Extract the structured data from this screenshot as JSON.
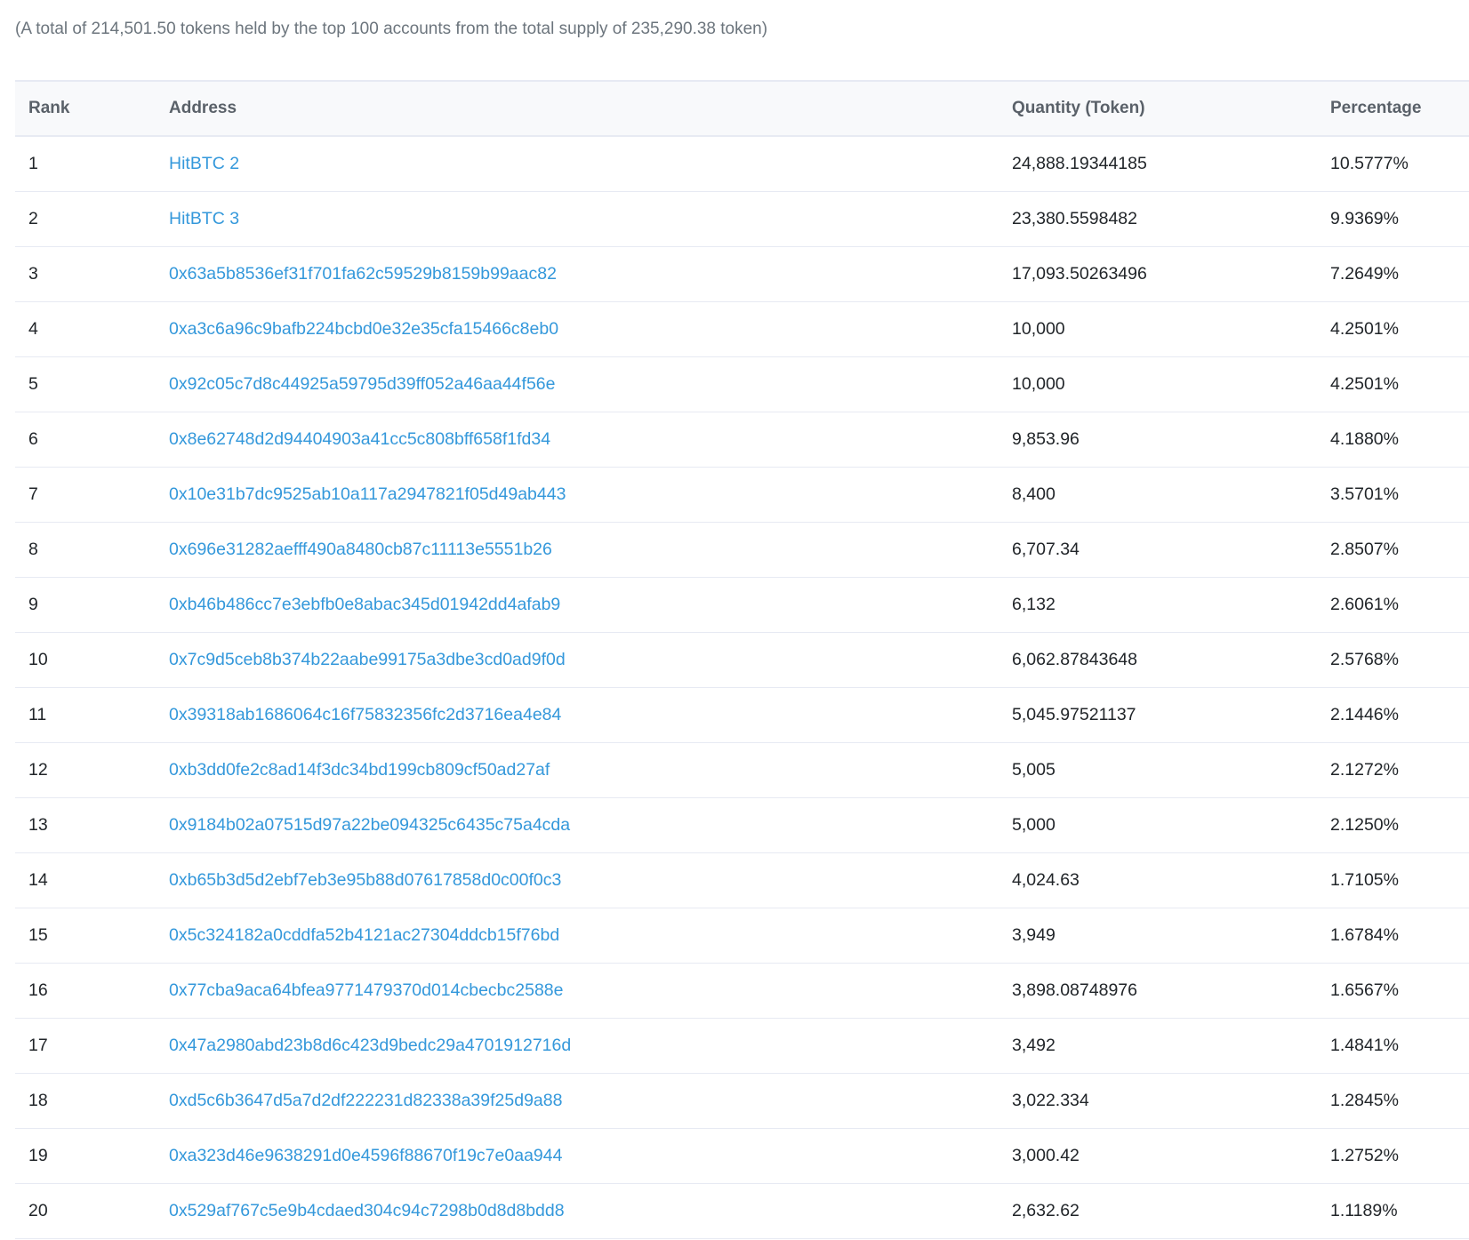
{
  "summary": "(A total of 214,501.50 tokens held by the top 100 accounts from the total supply of 235,290.38 token)",
  "colors": {
    "link": "#3498db",
    "header_bg": "#f8f9fb",
    "border": "#e7eaf3",
    "muted_text": "#6c757d"
  },
  "table": {
    "headers": {
      "rank": "Rank",
      "address": "Address",
      "quantity": "Quantity (Token)",
      "percentage": "Percentage"
    },
    "rows": [
      {
        "rank": "1",
        "address": "HitBTC 2",
        "quantity": "24,888.19344185",
        "percentage": "10.5777%"
      },
      {
        "rank": "2",
        "address": "HitBTC 3",
        "quantity": "23,380.5598482",
        "percentage": "9.9369%"
      },
      {
        "rank": "3",
        "address": "0x63a5b8536ef31f701fa62c59529b8159b99aac82",
        "quantity": "17,093.50263496",
        "percentage": "7.2649%"
      },
      {
        "rank": "4",
        "address": "0xa3c6a96c9bafb224bcbd0e32e35cfa15466c8eb0",
        "quantity": "10,000",
        "percentage": "4.2501%"
      },
      {
        "rank": "5",
        "address": "0x92c05c7d8c44925a59795d39ff052a46aa44f56e",
        "quantity": "10,000",
        "percentage": "4.2501%"
      },
      {
        "rank": "6",
        "address": "0x8e62748d2d94404903a41cc5c808bff658f1fd34",
        "quantity": "9,853.96",
        "percentage": "4.1880%"
      },
      {
        "rank": "7",
        "address": "0x10e31b7dc9525ab10a117a2947821f05d49ab443",
        "quantity": "8,400",
        "percentage": "3.5701%"
      },
      {
        "rank": "8",
        "address": "0x696e31282aefff490a8480cb87c11113e5551b26",
        "quantity": "6,707.34",
        "percentage": "2.8507%"
      },
      {
        "rank": "9",
        "address": "0xb46b486cc7e3ebfb0e8abac345d01942dd4afab9",
        "quantity": "6,132",
        "percentage": "2.6061%"
      },
      {
        "rank": "10",
        "address": "0x7c9d5ceb8b374b22aabe99175a3dbe3cd0ad9f0d",
        "quantity": "6,062.87843648",
        "percentage": "2.5768%"
      },
      {
        "rank": "11",
        "address": "0x39318ab1686064c16f75832356fc2d3716ea4e84",
        "quantity": "5,045.97521137",
        "percentage": "2.1446%"
      },
      {
        "rank": "12",
        "address": "0xb3dd0fe2c8ad14f3dc34bd199cb809cf50ad27af",
        "quantity": "5,005",
        "percentage": "2.1272%"
      },
      {
        "rank": "13",
        "address": "0x9184b02a07515d97a22be094325c6435c75a4cda",
        "quantity": "5,000",
        "percentage": "2.1250%"
      },
      {
        "rank": "14",
        "address": "0xb65b3d5d2ebf7eb3e95b88d07617858d0c00f0c3",
        "quantity": "4,024.63",
        "percentage": "1.7105%"
      },
      {
        "rank": "15",
        "address": "0x5c324182a0cddfa52b4121ac27304ddcb15f76bd",
        "quantity": "3,949",
        "percentage": "1.6784%"
      },
      {
        "rank": "16",
        "address": "0x77cba9aca64bfea9771479370d014cbecbc2588e",
        "quantity": "3,898.08748976",
        "percentage": "1.6567%"
      },
      {
        "rank": "17",
        "address": "0x47a2980abd23b8d6c423d9bedc29a4701912716d",
        "quantity": "3,492",
        "percentage": "1.4841%"
      },
      {
        "rank": "18",
        "address": "0xd5c6b3647d5a7d2df222231d82338a39f25d9a88",
        "quantity": "3,022.334",
        "percentage": "1.2845%"
      },
      {
        "rank": "19",
        "address": "0xa323d46e9638291d0e4596f88670f19c7e0aa944",
        "quantity": "3,000.42",
        "percentage": "1.2752%"
      },
      {
        "rank": "20",
        "address": "0x529af767c5e9b4cdaed304c94c7298b0d8d8bdd8",
        "quantity": "2,632.62",
        "percentage": "1.1189%"
      }
    ]
  }
}
